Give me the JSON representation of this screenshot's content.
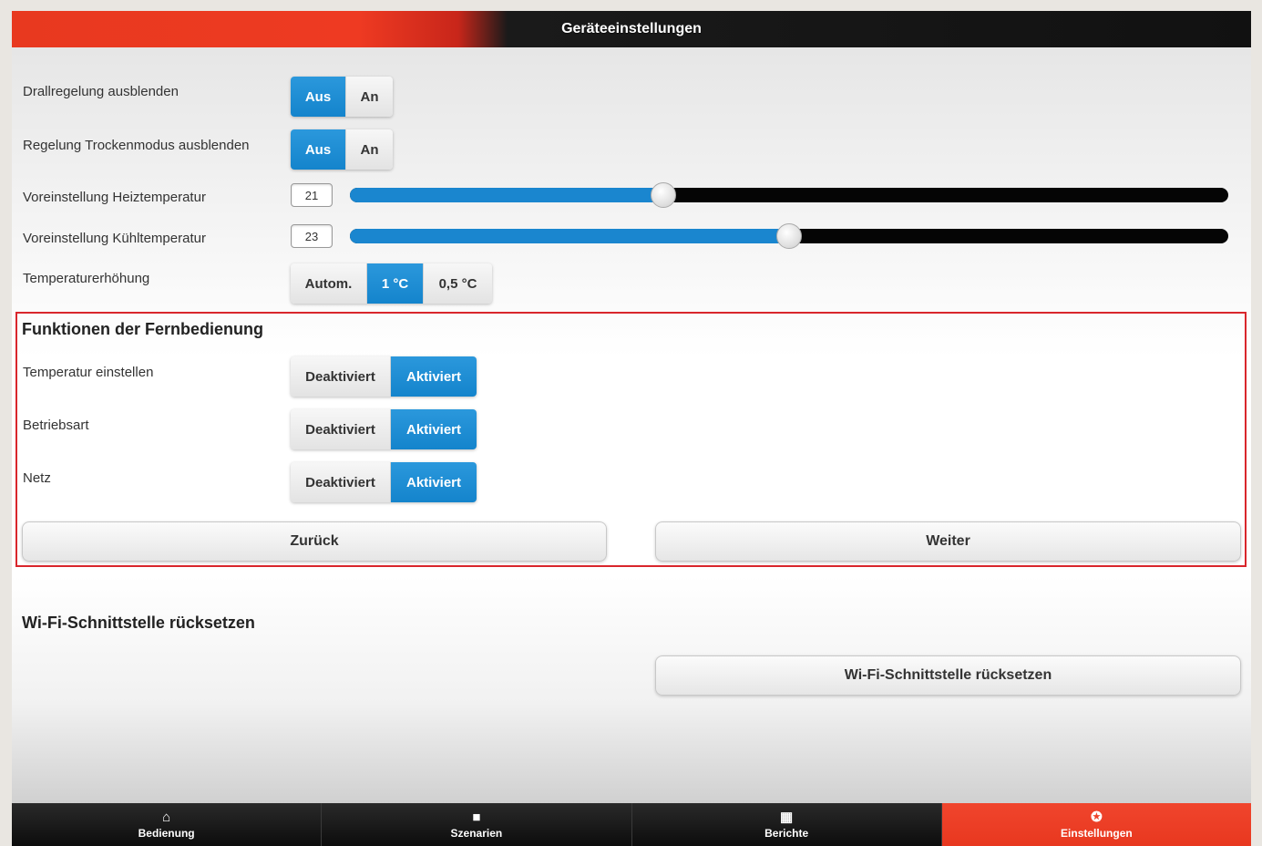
{
  "header": {
    "title": "Geräteeinstellungen"
  },
  "settings": {
    "drall": {
      "label": "Drallregelung ausblenden",
      "options": [
        "Aus",
        "An"
      ],
      "selected": "Aus"
    },
    "trocken": {
      "label": "Regelung Trockenmodus ausblenden",
      "options": [
        "Aus",
        "An"
      ],
      "selected": "Aus"
    },
    "heiz": {
      "label": "Voreinstellung Heiztemperatur",
      "value": "21",
      "slider_fraction": 0.357
    },
    "kuehl": {
      "label": "Voreinstellung Kühltemperatur",
      "value": "23",
      "slider_fraction": 0.5
    },
    "erhoehung": {
      "label": "Temperaturerhöhung",
      "options": [
        "Autom.",
        "1 °C",
        "0,5 °C"
      ],
      "selected": "1 °C"
    }
  },
  "remote": {
    "title": "Funktionen der Fernbedienung",
    "rows": [
      {
        "label": "Temperatur einstellen",
        "options": [
          "Deaktiviert",
          "Aktiviert"
        ],
        "selected": "Aktiviert"
      },
      {
        "label": "Betriebsart",
        "options": [
          "Deaktiviert",
          "Aktiviert"
        ],
        "selected": "Aktiviert"
      },
      {
        "label": "Netz",
        "options": [
          "Deaktiviert",
          "Aktiviert"
        ],
        "selected": "Aktiviert"
      }
    ],
    "back_label": "Zurück",
    "next_label": "Weiter"
  },
  "wifi": {
    "title": "Wi-Fi-Schnittstelle rücksetzen",
    "button_label": "Wi-Fi-Schnittstelle rücksetzen"
  },
  "tabs": [
    {
      "label": "Bedienung",
      "icon": "home-icon",
      "glyph": "⌂",
      "active": false
    },
    {
      "label": "Szenarien",
      "icon": "video-camera-icon",
      "glyph": "■",
      "active": false
    },
    {
      "label": "Berichte",
      "icon": "grid-icon",
      "glyph": "▦",
      "active": false
    },
    {
      "label": "Einstellungen",
      "icon": "gear-icon",
      "glyph": "✪",
      "active": true
    }
  ],
  "colors": {
    "accent_blue": "#1484cc",
    "brand_red": "#e8381f",
    "panel_border": "#d9262c"
  }
}
